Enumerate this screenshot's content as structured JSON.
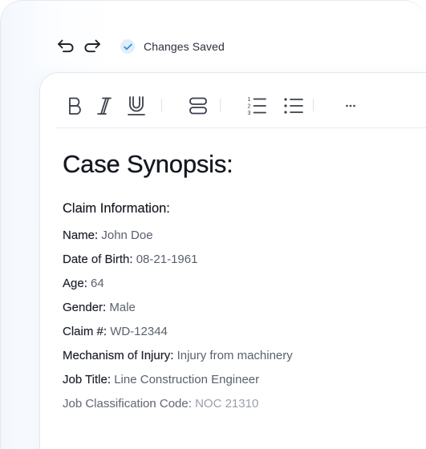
{
  "status": {
    "saved_text": "Changes Saved",
    "accent_color": "#2f8fe8"
  },
  "toolbar": {
    "tools": [
      {
        "name": "bold",
        "icon": "bold-icon"
      },
      {
        "name": "italic",
        "icon": "italic-icon"
      },
      {
        "name": "underline",
        "icon": "underline-icon"
      },
      {
        "name": "block",
        "icon": "block-layout-icon"
      },
      {
        "name": "numbered-list",
        "icon": "numbered-list-icon",
        "markers": [
          "1",
          "2",
          "3"
        ]
      },
      {
        "name": "bulleted-list",
        "icon": "bulleted-list-icon"
      },
      {
        "name": "more",
        "icon": "more-icon"
      }
    ]
  },
  "document": {
    "title": "Case Synopsis:",
    "section_title": "Claim Information:",
    "fields": [
      {
        "label": "Name:",
        "value": "John Doe"
      },
      {
        "label": "Date of Birth:",
        "value": "08-21-1961"
      },
      {
        "label": "Age:",
        "value": "64"
      },
      {
        "label": "Gender:",
        "value": "Male"
      },
      {
        "label": "Claim #:",
        "value": "WD-12344"
      },
      {
        "label": "Mechanism of Injury:",
        "value": "Injury from machinery"
      },
      {
        "label": "Job Title:",
        "value": "Line Construction Engineer"
      },
      {
        "label": "Job Classification Code:",
        "value": "NOC 21310"
      }
    ]
  }
}
